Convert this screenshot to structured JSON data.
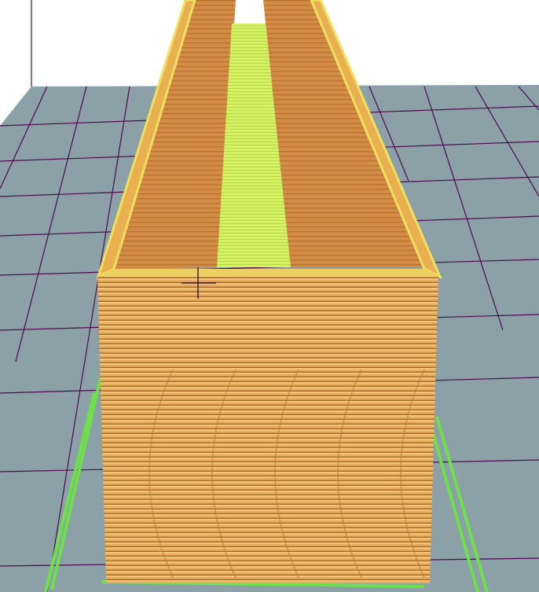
{
  "viewport": {
    "label": "",
    "colors": {
      "background": "#ffffff",
      "bed": "#8ba0a7",
      "grid_line": "#4d0a4d",
      "wall_outer": "#e3a95a",
      "wall_line_dark": "#b8742e",
      "wall_inner": "#d08a45",
      "top_infill": "#d4f060",
      "perimeter_top": "#f0e060",
      "skirt": "#6ee04a"
    }
  }
}
